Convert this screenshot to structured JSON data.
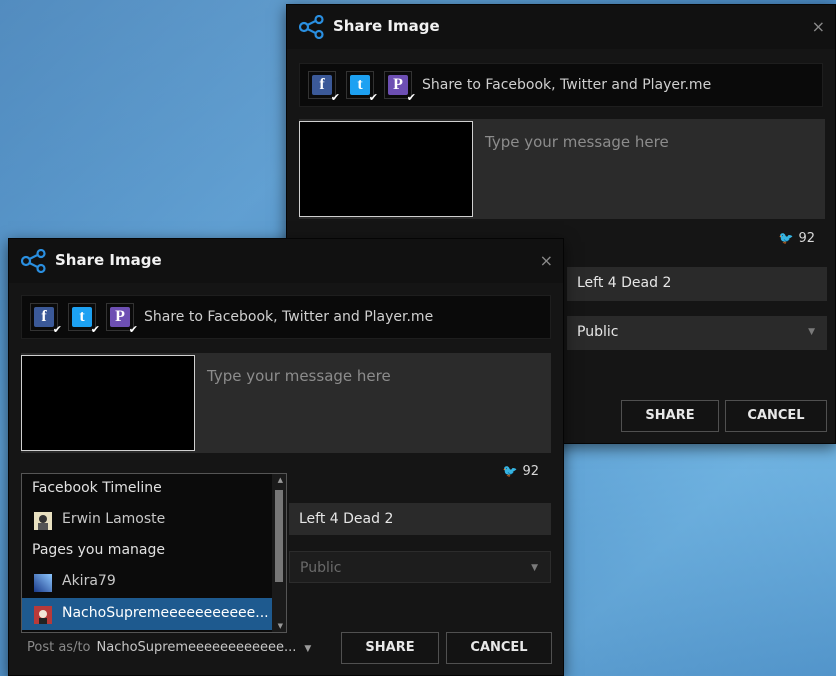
{
  "dialogs": {
    "back": {
      "title": "Share Image",
      "close": "×",
      "share_text": "Share to Facebook, Twitter and Player.me",
      "message_placeholder": "Type your message here",
      "char_count": "92",
      "game": "Left 4 Dead 2",
      "visibility": "Public",
      "share_button": "SHARE",
      "cancel_button": "CANCEL"
    },
    "front": {
      "title": "Share Image",
      "close": "×",
      "share_text": "Share to Facebook, Twitter and Player.me",
      "message_placeholder": "Type your message here",
      "char_count": "92",
      "game": "Left 4 Dead 2",
      "visibility": "Public",
      "post_as_label": "Post as/to",
      "post_as_value": "NachoSupremeeeeeeeeeeee...",
      "share_button": "SHARE",
      "cancel_button": "CANCEL"
    }
  },
  "services": [
    {
      "name": "facebook",
      "glyph": "f",
      "color": "#3b5998"
    },
    {
      "name": "twitter",
      "glyph": "t",
      "color": "#1da1f2"
    },
    {
      "name": "playerme",
      "glyph": "P",
      "color": "#6d4fb3"
    }
  ],
  "post_as_dropdown": {
    "groups": [
      {
        "label": "Facebook Timeline",
        "items": [
          "Erwin Lamoste"
        ]
      },
      {
        "label": "Pages you manage",
        "items": [
          "Akira79",
          "NachoSupremeeeeeeeeeee..."
        ]
      }
    ],
    "selected": "NachoSupremeeeeeeeeeee..."
  },
  "colors": {
    "accent": "#1e5a8f",
    "twitter_bird": "#3b9ce0",
    "share_icon": "#2a8fe0"
  }
}
